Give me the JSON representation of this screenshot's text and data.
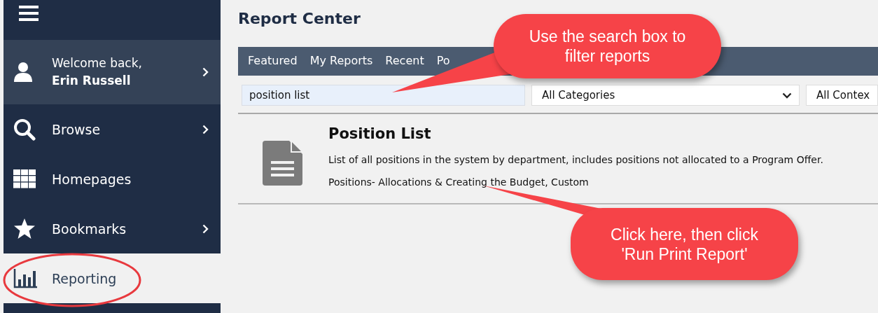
{
  "sidebar": {
    "items": [
      {
        "kind": "user",
        "greeting": "Welcome back,",
        "name": "Erin Russell",
        "has_submenu": true,
        "selected": false
      },
      {
        "kind": "link",
        "label": "Browse",
        "has_submenu": true,
        "selected": false
      },
      {
        "kind": "link",
        "label": "Homepages",
        "has_submenu": false,
        "selected": false
      },
      {
        "kind": "link",
        "label": "Bookmarks",
        "has_submenu": true,
        "selected": false
      },
      {
        "kind": "link",
        "label": "Reporting",
        "has_submenu": false,
        "selected": true
      }
    ]
  },
  "page": {
    "title": "Report Center",
    "tabs": [
      {
        "label": "Featured",
        "selected": false
      },
      {
        "label": "My Reports",
        "selected": false
      },
      {
        "label": "Recent",
        "selected": false
      },
      {
        "label": "Po",
        "selected": false
      }
    ],
    "search": {
      "value": "position list"
    },
    "filters": [
      {
        "value": "All Categories"
      },
      {
        "value": "All Contex"
      }
    ],
    "results": [
      {
        "title": "Position List",
        "description": "List of all positions in the system by department, includes positions not allocated to a Program Offer.",
        "tags": "Positions- Allocations & Creating the Budget, Custom"
      }
    ]
  },
  "callouts": [
    {
      "text": "Use the search box to filter reports"
    },
    {
      "text": "Click here, then click 'Run Print Report'"
    }
  ]
}
